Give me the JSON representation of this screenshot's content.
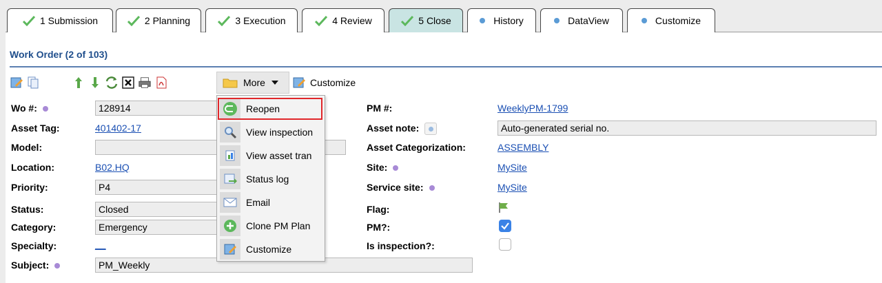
{
  "tabs": [
    {
      "label": "1 Submission",
      "type": "check"
    },
    {
      "label": "2 Planning",
      "type": "check"
    },
    {
      "label": "3 Execution",
      "type": "check"
    },
    {
      "label": "4 Review",
      "type": "check"
    },
    {
      "label": "5 Close",
      "type": "check",
      "active": true
    },
    {
      "label": "History",
      "type": "dot"
    },
    {
      "label": "DataView",
      "type": "dot"
    },
    {
      "label": "Customize",
      "type": "dot"
    }
  ],
  "header": {
    "title": "Work Order (2 of 103)"
  },
  "toolbar": {
    "more_label": "More",
    "customize_label": "Customize"
  },
  "menu": {
    "items": [
      "Reopen",
      "View inspection",
      "View asset tran",
      "Status log",
      "Email",
      "Clone PM Plan",
      "Customize"
    ]
  },
  "form": {
    "wo_label": "Wo #:",
    "wo_value": "128914",
    "asset_tag_label": "Asset Tag:",
    "asset_tag_value": "401402-17",
    "model_label": "Model:",
    "model_value": "",
    "location_label": "Location:",
    "location_value": "B02.HQ",
    "priority_label": "Priority:",
    "priority_value": "P4",
    "status_label": "Status:",
    "status_value": "Closed",
    "category_label": "Category:",
    "category_value": "Emergency",
    "specialty_label": "Specialty:",
    "specialty_value": "__",
    "subject_label": "Subject:",
    "subject_value": "PM_Weekly",
    "pm_label": "PM #:",
    "pm_value": "WeeklyPM-1799",
    "asset_note_label": "Asset note:",
    "asset_note_value": "Auto-generated serial no.",
    "asset_cat_label": "Asset Categorization:",
    "asset_cat_value": "ASSEMBLY",
    "site_label": "Site:",
    "site_value": "MySite",
    "service_site_label": "Service site:",
    "service_site_value": "MySite",
    "flag_label": "Flag:",
    "pmq_label": "PM?:",
    "pmq_checked": true,
    "inspection_label": "Is inspection?:",
    "inspection_checked": false
  },
  "colors": {
    "accent": "#1f4e8c",
    "active_tab": "#c9e4e3",
    "highlight": "#e0262a"
  }
}
